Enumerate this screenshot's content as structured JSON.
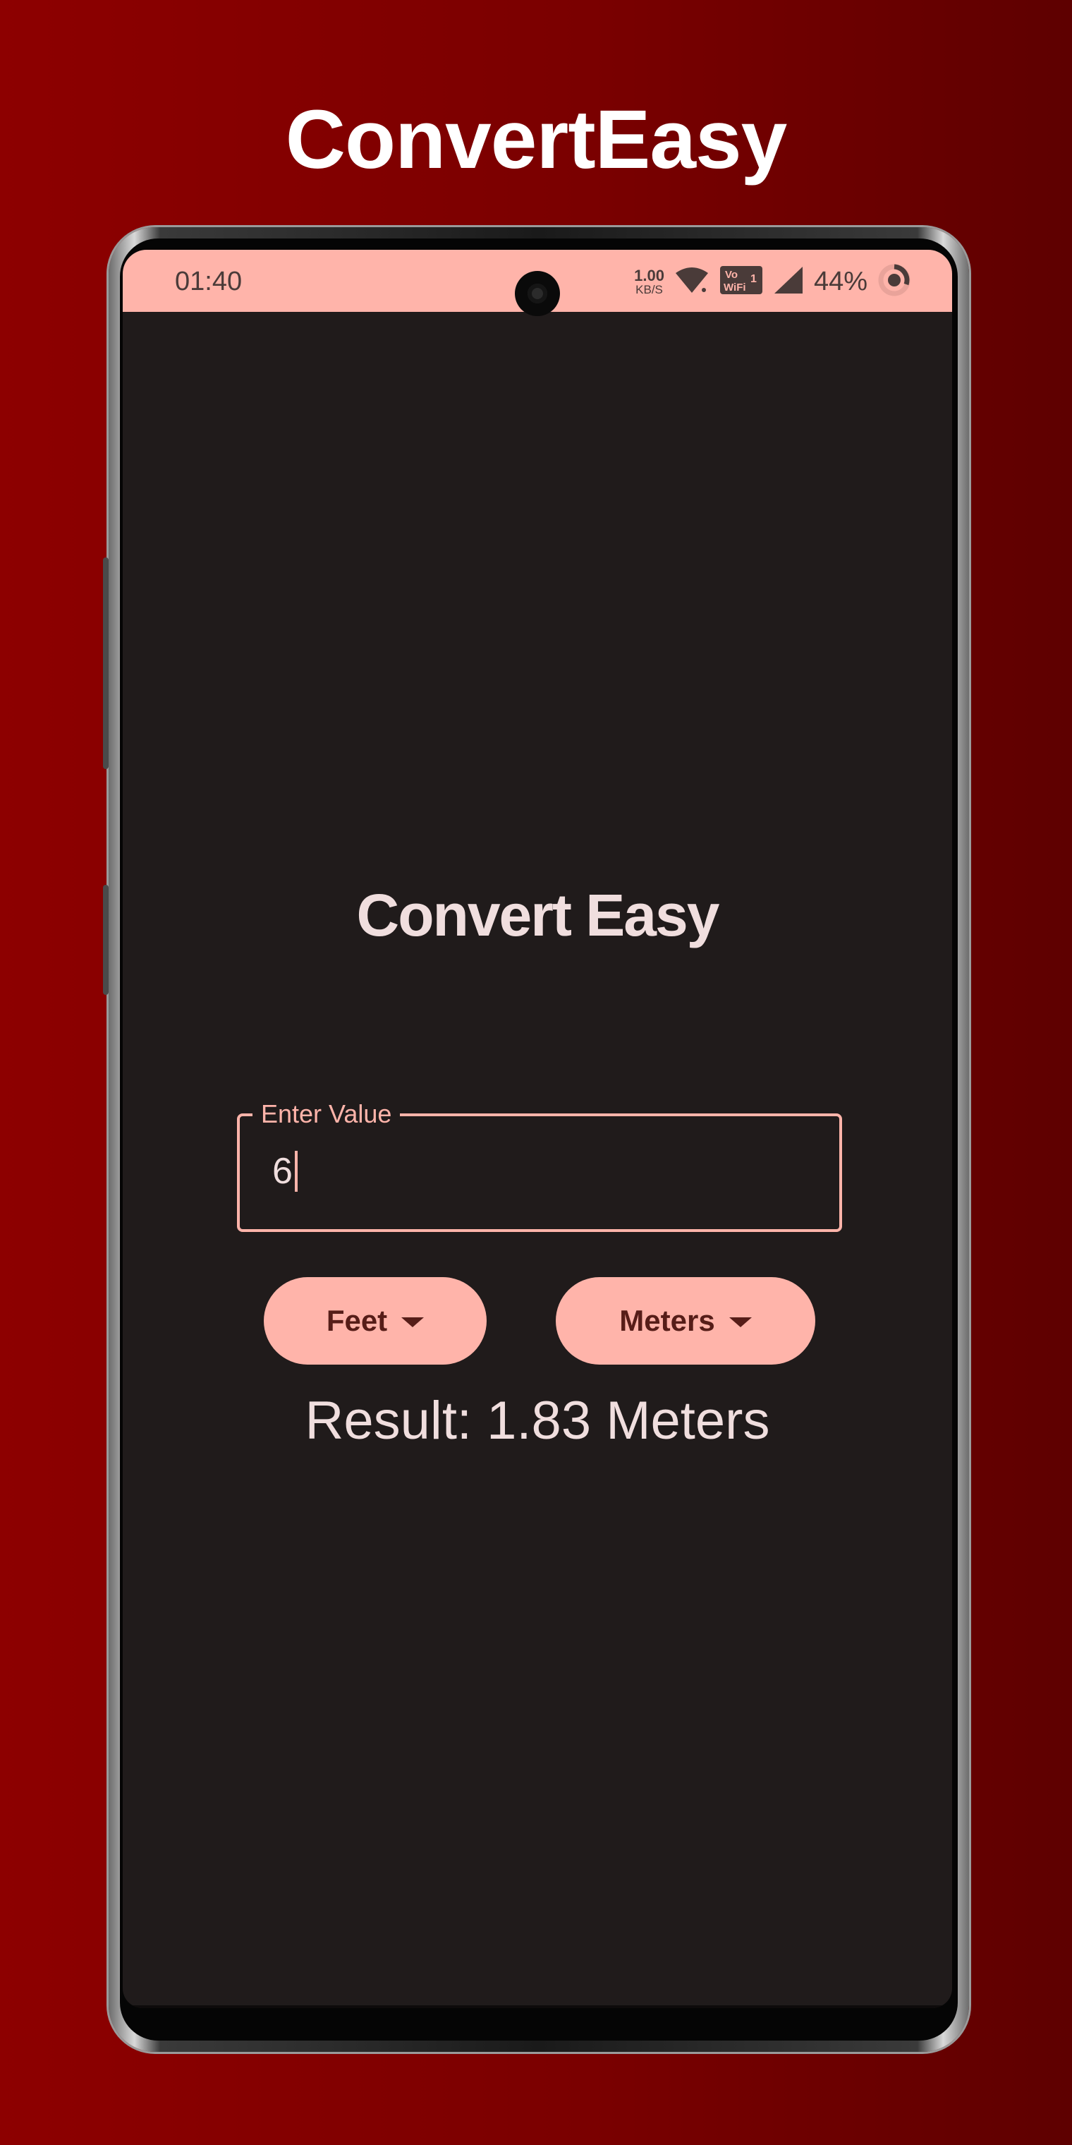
{
  "promo": {
    "title": "ConvertEasy"
  },
  "status_bar": {
    "time": "01:40",
    "net_speed_value": "1.00",
    "net_speed_unit": "KB/S",
    "volte_label": "Vo WiFi 1",
    "battery_percent": "44%",
    "icons": [
      "wifi-icon",
      "vowifi-icon",
      "cell-signal-icon",
      "battery-ring-icon"
    ]
  },
  "app": {
    "title": "Convert Easy",
    "input": {
      "label": "Enter Value",
      "value": "6"
    },
    "from_unit": {
      "label": "Feet",
      "icon": "dropdown-arrow-icon"
    },
    "to_unit": {
      "label": "Meters",
      "icon": "dropdown-arrow-icon"
    },
    "result": "Result: 1.83 Meters"
  },
  "colors": {
    "background_red": "#8d0000",
    "accent_pink": "#ffb4aa",
    "screen_bg": "#201b1b",
    "text_light": "#f0dede",
    "button_text": "#561d18"
  }
}
